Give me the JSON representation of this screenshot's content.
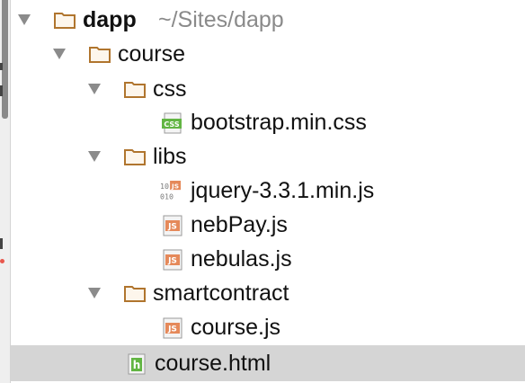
{
  "project": {
    "root_label": "dapp",
    "root_path": "~/Sites/dapp"
  },
  "tree": {
    "course": "course",
    "css": "css",
    "bootstrap": "bootstrap.min.css",
    "libs": "libs",
    "jquery": "jquery-3.3.1.min.js",
    "nebpay": "nebPay.js",
    "nebulas": "nebulas.js",
    "smartcontract": "smartcontract",
    "coursejs": "course.js",
    "coursehtml": "course.html"
  },
  "icons": {
    "css_badge": "CSS",
    "js_badge": "JS",
    "html_badge": "h",
    "binary_badge": "10\n010"
  },
  "colors": {
    "folder_outline": "#b0752e",
    "folder_fill": "#fdf6ec",
    "js_badge": "#e5895a",
    "css_badge": "#62b543",
    "html_badge": "#62b543",
    "selection": "#d5d5d5"
  }
}
